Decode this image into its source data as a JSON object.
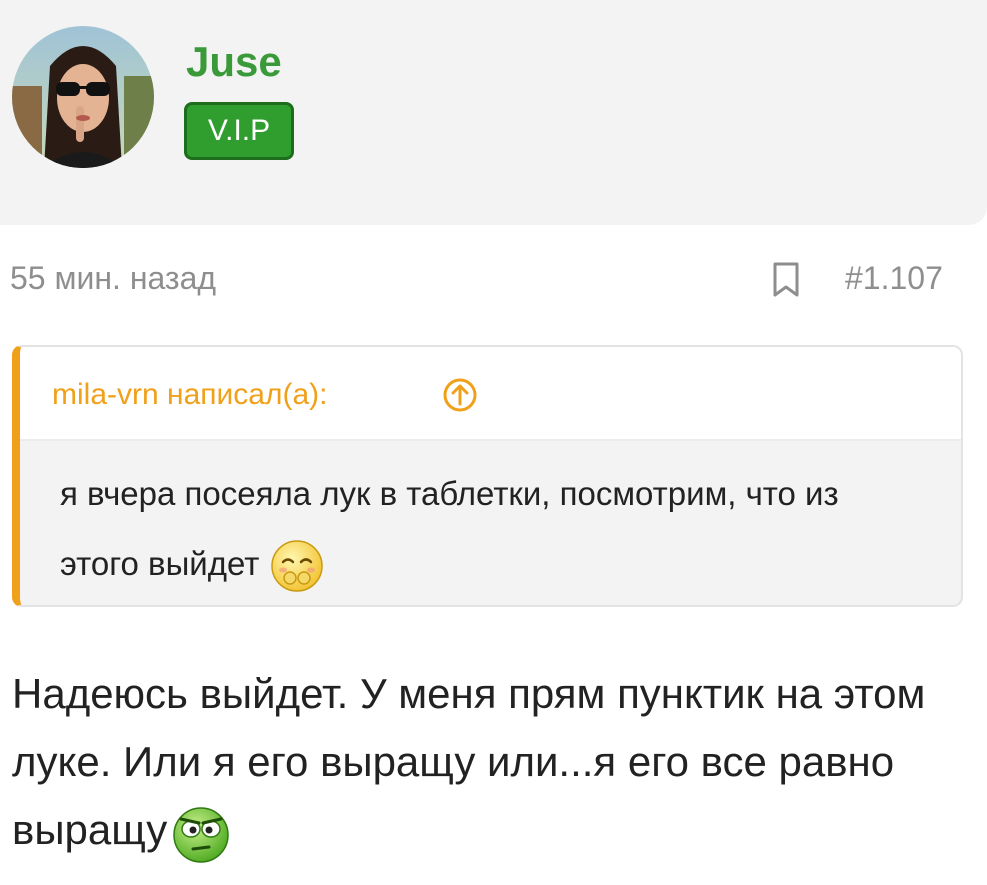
{
  "user": {
    "name": "Juse",
    "badge": "V.I.P"
  },
  "post": {
    "time": "55 мин. назад",
    "number": "#1.107",
    "quote": {
      "author": "mila-vrn написал(а):",
      "text": "я вчера посеяла лук в таблетки, посмотрим, что из этого выйдет",
      "smiley_icon": "smiling-face-icon"
    },
    "body": "Надеюсь выйдет. У меня прям пунктик на этом луке. Или я его выращу или...я его все равно выращу",
    "body_smiley_icon": "green-grumpy-face-icon"
  },
  "colors": {
    "username": "#3a9a3a",
    "badge_bg": "#2f9e2f",
    "quote_accent": "#f0a01a",
    "meta_text": "#8e8e8e"
  }
}
